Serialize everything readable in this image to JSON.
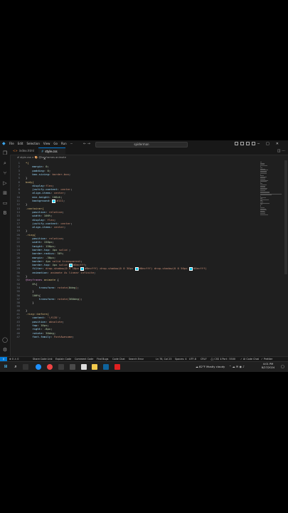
{
  "titlebar": {
    "menu": [
      "File",
      "Edit",
      "Selection",
      "View",
      "Go",
      "Run",
      "···"
    ],
    "search": "spiderman",
    "nav_arrows": "← →"
  },
  "tabs": [
    {
      "label": "index.html",
      "icon": "html-icon",
      "active": false
    },
    {
      "label": "style.css",
      "icon": "css-icon",
      "active": true,
      "close": "×"
    }
  ],
  "breadcrumb": "# style.css > 🎨 @keyframes animate",
  "editor": {
    "lines": [
      {
        "n": "1",
        "tokens": [
          [
            "sel",
            "*{"
          ]
        ]
      },
      {
        "n": "2",
        "tokens": [
          [
            "prop",
            "    margin"
          ],
          [
            "pun",
            ": "
          ],
          [
            "num",
            "0"
          ],
          [
            "pun",
            ";"
          ]
        ]
      },
      {
        "n": "3",
        "tokens": [
          [
            "prop",
            "    padding"
          ],
          [
            "pun",
            ": "
          ],
          [
            "num",
            "0"
          ],
          [
            "pun",
            ";"
          ]
        ]
      },
      {
        "n": "4",
        "tokens": [
          [
            "prop",
            "    box-sizing"
          ],
          [
            "pun",
            ": "
          ],
          [
            "val",
            "border-box"
          ],
          [
            "pun",
            ";"
          ]
        ]
      },
      {
        "n": "5",
        "tokens": [
          [
            "pun",
            "}"
          ]
        ]
      },
      {
        "n": "6",
        "tokens": [
          [
            "sel",
            "body{"
          ]
        ]
      },
      {
        "n": "7",
        "tokens": [
          [
            "prop",
            "    display"
          ],
          [
            "pun",
            ":"
          ],
          [
            "val",
            "flex"
          ],
          [
            "pun",
            ";"
          ]
        ]
      },
      {
        "n": "8",
        "tokens": [
          [
            "prop",
            "    justify-content"
          ],
          [
            "pun",
            ": "
          ],
          [
            "val",
            "center"
          ],
          [
            "pun",
            ";"
          ]
        ]
      },
      {
        "n": "9",
        "tokens": [
          [
            "prop",
            "    align-items"
          ],
          [
            "pun",
            ": "
          ],
          [
            "val",
            "center"
          ],
          [
            "pun",
            ";"
          ]
        ]
      },
      {
        "n": "10",
        "tokens": [
          [
            "prop",
            "    min-height"
          ],
          [
            "pun",
            ": "
          ],
          [
            "num",
            "100vh"
          ],
          [
            "pun",
            ";"
          ]
        ]
      },
      {
        "n": "11",
        "tokens": [
          [
            "prop",
            "    background"
          ],
          [
            "pun",
            ": "
          ],
          [
            "sw",
            ""
          ],
          [
            "val",
            "#111"
          ],
          [
            "pun",
            ";"
          ]
        ]
      },
      {
        "n": "12",
        "tokens": [
          [
            "pun",
            "}"
          ]
        ]
      },
      {
        "n": "13",
        "tokens": [
          [
            "sel",
            ".container{"
          ]
        ]
      },
      {
        "n": "14",
        "tokens": [
          [
            "prop",
            "    position"
          ],
          [
            "pun",
            ": "
          ],
          [
            "val",
            "relative"
          ],
          [
            "pun",
            ";"
          ]
        ]
      },
      {
        "n": "15",
        "tokens": [
          [
            "prop",
            "    width"
          ],
          [
            "pun",
            ": "
          ],
          [
            "num",
            "100%"
          ],
          [
            "pun",
            ";"
          ]
        ]
      },
      {
        "n": "16",
        "tokens": [
          [
            "prop",
            "    display"
          ],
          [
            "pun",
            ": "
          ],
          [
            "val",
            "flex"
          ],
          [
            "pun",
            ";"
          ]
        ]
      },
      {
        "n": "17",
        "tokens": [
          [
            "prop",
            "    justify-content"
          ],
          [
            "pun",
            ": "
          ],
          [
            "val",
            "center"
          ],
          [
            "pun",
            ";"
          ]
        ]
      },
      {
        "n": "18",
        "tokens": [
          [
            "prop",
            "    align-items"
          ],
          [
            "pun",
            ": "
          ],
          [
            "val",
            "center"
          ],
          [
            "pun",
            ";"
          ]
        ]
      },
      {
        "n": "19",
        "tokens": [
          [
            "pun",
            "}"
          ]
        ]
      },
      {
        "n": "20",
        "tokens": [
          [
            "sel",
            ".ring{"
          ]
        ]
      },
      {
        "n": "21",
        "tokens": [
          [
            "prop",
            "    position"
          ],
          [
            "pun",
            ": "
          ],
          [
            "val",
            "relative"
          ],
          [
            "pun",
            ";"
          ]
        ]
      },
      {
        "n": "22",
        "tokens": [
          [
            "prop",
            "    width"
          ],
          [
            "pun",
            ": "
          ],
          [
            "num",
            "150px"
          ],
          [
            "pun",
            ";"
          ]
        ]
      },
      {
        "n": "23",
        "tokens": [
          [
            "prop",
            "    height"
          ],
          [
            "pun",
            ": "
          ],
          [
            "num",
            "150px"
          ],
          [
            "pun",
            ";"
          ]
        ]
      },
      {
        "n": "24",
        "tokens": [
          [
            "prop",
            "    border-top"
          ],
          [
            "pun",
            ": "
          ],
          [
            "num",
            "4px"
          ],
          [
            "val",
            " solid "
          ],
          [
            "pun",
            ";"
          ]
        ]
      },
      {
        "n": "25",
        "tokens": [
          [
            "prop",
            "    border-radius"
          ],
          [
            "pun",
            ": "
          ],
          [
            "num",
            "50%"
          ],
          [
            "pun",
            ";"
          ]
        ]
      },
      {
        "n": "26",
        "tokens": [
          [
            "prop",
            "    margin"
          ],
          [
            "pun",
            ": "
          ],
          [
            "num",
            "-30px"
          ],
          [
            "pun",
            ";"
          ]
        ]
      },
      {
        "n": "27",
        "tokens": [
          [
            "prop",
            "    border"
          ],
          [
            "pun",
            ": "
          ],
          [
            "num",
            "4px"
          ],
          [
            "val",
            " solid transparent"
          ],
          [
            "pun",
            ";"
          ]
        ]
      },
      {
        "n": "28",
        "tokens": [
          [
            "prop",
            "    border-top"
          ],
          [
            "pun",
            ": "
          ],
          [
            "num",
            "4px"
          ],
          [
            "val",
            " solid "
          ],
          [
            "sw",
            ""
          ],
          [
            "val",
            "#0ecfff"
          ],
          [
            "pun",
            ";"
          ]
        ]
      },
      {
        "n": "29",
        "tokens": [
          [
            "prop",
            "    filter"
          ],
          [
            "pun",
            ": "
          ],
          [
            "val",
            "drop-shadow(0 0 10px "
          ],
          [
            "sw",
            ""
          ],
          [
            "val",
            "#0ecfff) drop-shadow(0 0 30px "
          ],
          [
            "sw",
            ""
          ],
          [
            "val",
            "#0ecfff) drop-shadow(0 0 50px "
          ],
          [
            "sw",
            ""
          ],
          [
            "val",
            "#0ecfff)"
          ]
        ]
      },
      {
        "n": "30",
        "tokens": [
          [
            "prop",
            "    animation"
          ],
          [
            "pun",
            ": "
          ],
          [
            "val",
            "animate 4s linear infinite"
          ],
          [
            "pun",
            ";"
          ]
        ]
      },
      {
        "n": "31",
        "tokens": [
          [
            "pun",
            "}"
          ]
        ]
      },
      {
        "n": "32",
        "tokens": [
          [
            "at",
            "@keyframes"
          ],
          [
            "sel",
            " animate "
          ],
          [
            "pun",
            "{"
          ]
        ]
      },
      {
        "n": "33",
        "tokens": [
          [
            "num",
            "    0%"
          ],
          [
            "pun",
            "{"
          ]
        ]
      },
      {
        "n": "34",
        "tokens": [
          [
            "prop",
            "        transform"
          ],
          [
            "pun",
            ": "
          ],
          [
            "val",
            "rotate("
          ],
          [
            "num",
            "0deg"
          ],
          [
            "val",
            ")"
          ],
          [
            "pun",
            ";"
          ]
        ]
      },
      {
        "n": "35",
        "tokens": [
          [
            "pun",
            "    }"
          ]
        ]
      },
      {
        "n": "36",
        "tokens": [
          [
            "num",
            "    100%"
          ],
          [
            "pun",
            "{"
          ]
        ]
      },
      {
        "n": "37",
        "tokens": [
          [
            "prop",
            "        transform"
          ],
          [
            "pun",
            ": "
          ],
          [
            "val",
            "rotate("
          ],
          [
            "num",
            "360deg"
          ],
          [
            "val",
            ")"
          ],
          [
            "pun",
            ";"
          ]
        ]
      },
      {
        "n": "38",
        "tokens": [
          [
            "pun",
            "    }"
          ]
        ]
      },
      {
        "n": "39",
        "tokens": [
          [
            "pun",
            ""
          ]
        ]
      },
      {
        "n": "40",
        "tokens": [
          [
            "pun",
            "}"
          ]
        ]
      },
      {
        "n": "41",
        "tokens": [
          [
            "sel",
            ".ring::before{"
          ]
        ]
      },
      {
        "n": "42",
        "tokens": [
          [
            "prop",
            "    content"
          ],
          [
            "pun",
            ": "
          ],
          [
            "val",
            "'\\f135'"
          ],
          [
            "pun",
            ";"
          ]
        ]
      },
      {
        "n": "43",
        "tokens": [
          [
            "prop",
            "    position"
          ],
          [
            "pun",
            ": "
          ],
          [
            "val",
            "absolute"
          ],
          [
            "pun",
            ";"
          ]
        ]
      },
      {
        "n": "44",
        "tokens": [
          [
            "prop",
            "    top"
          ],
          [
            "pun",
            ": "
          ],
          [
            "num",
            "10px"
          ],
          [
            "pun",
            ";"
          ]
        ]
      },
      {
        "n": "45",
        "tokens": [
          [
            "prop",
            "    right"
          ],
          [
            "pun",
            ": "
          ],
          [
            "num",
            "-8px"
          ],
          [
            "pun",
            ";"
          ]
        ]
      },
      {
        "n": "46",
        "tokens": [
          [
            "prop",
            "    rotate"
          ],
          [
            "pun",
            ": "
          ],
          [
            "num",
            "30deg"
          ],
          [
            "pun",
            ";"
          ]
        ]
      },
      {
        "n": "47",
        "tokens": [
          [
            "prop",
            "    font-family"
          ],
          [
            "pun",
            ": "
          ],
          [
            "val",
            "FontAwesome"
          ],
          [
            "pun",
            ";"
          ]
        ]
      }
    ]
  },
  "statusbar": {
    "left": [
      "⊗ 0 ⚠ 0",
      "Share Code Link",
      "Explain Code",
      "Comment Code",
      "Find Bugs",
      "Code Chat",
      "Search Error"
    ],
    "right": [
      "Ln 78, Col 23",
      "Spaces: 4",
      "UTF-8",
      "CRLF",
      "{} CSS",
      "ℹ Port : 5500",
      "✓ AI Code Chat",
      "✓ Prettier"
    ]
  },
  "taskbar": {
    "weather": "82°F  Mostly cloudy",
    "time": "4:01 PM",
    "date": "8/27/2024"
  },
  "colors": {
    "accent": "#0078d4",
    "editor_bg": "#1f1f1f"
  }
}
